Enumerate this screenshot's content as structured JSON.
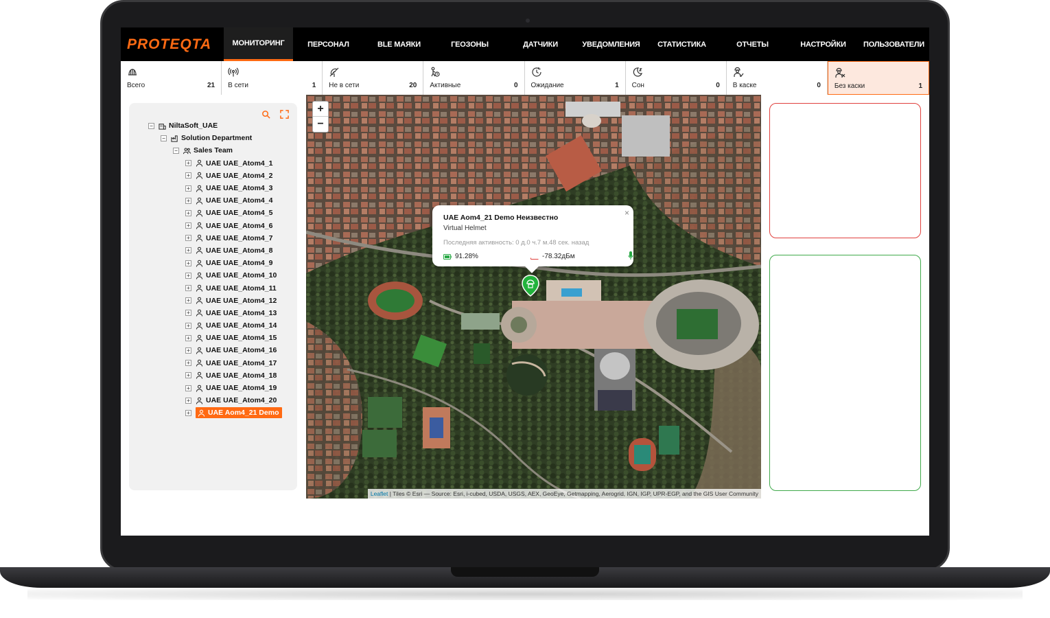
{
  "brand": {
    "logo": "PROTEQTA",
    "accent": "#ff6a13"
  },
  "nav": {
    "items": [
      {
        "label": "МОНИТОРИНГ",
        "active": true
      },
      {
        "label": "ПЕРСОНАЛ"
      },
      {
        "label": "BLE МАЯКИ"
      },
      {
        "label": "ГЕОЗОНЫ"
      },
      {
        "label": "ДАТЧИКИ"
      },
      {
        "label": "УВЕДОМЛЕНИЯ"
      },
      {
        "label": "СТАТИСТИКА"
      },
      {
        "label": "ОТЧЕТЫ"
      },
      {
        "label": "НАСТРОЙКИ"
      },
      {
        "label": "ПОЛЬЗОВАТЕЛИ"
      }
    ]
  },
  "stats": [
    {
      "label": "Всего",
      "value": "21",
      "icon": "helmet-icon"
    },
    {
      "label": "В сети",
      "value": "1",
      "icon": "signal-icon"
    },
    {
      "label": "Не в сети",
      "value": "20",
      "icon": "no-signal-icon"
    },
    {
      "label": "Активные",
      "value": "0",
      "icon": "walking-icon"
    },
    {
      "label": "Ожидание",
      "value": "1",
      "icon": "waiting-icon"
    },
    {
      "label": "Сон",
      "value": "0",
      "icon": "sleep-icon"
    },
    {
      "label": "В каске",
      "value": "0",
      "icon": "worker-helmet-icon"
    },
    {
      "label": "Без каски",
      "value": "1",
      "icon": "worker-no-helmet-icon",
      "highlight": true
    }
  ],
  "tree": {
    "org": "NiltaSoft_UAE",
    "department": "Solution Department",
    "team": "Sales Team",
    "members": [
      "UAE UAE_Atom4_1",
      "UAE UAE_Atom4_2",
      "UAE UAE_Atom4_3",
      "UAE UAE_Atom4_4",
      "UAE UAE_Atom4_5",
      "UAE UAE_Atom4_6",
      "UAE UAE_Atom4_7",
      "UAE UAE_Atom4_8",
      "UAE UAE_Atom4_9",
      "UAE UAE_Atom4_10",
      "UAE UAE_Atom4_11",
      "UAE UAE_Atom4_12",
      "UAE UAE_Atom4_13",
      "UAE UAE_Atom4_14",
      "UAE UAE_Atom4_15",
      "UAE UAE_Atom4_16",
      "UAE UAE_Atom4_17",
      "UAE UAE_Atom4_18",
      "UAE UAE_Atom4_19",
      "UAE UAE_Atom4_20"
    ],
    "selected": "UAE Aom4_21 Demo"
  },
  "map": {
    "zoom_in": "+",
    "zoom_out": "−",
    "attribution_link": "Leaflet",
    "attribution_text": "| Tiles © Esri — Source: Esri, i-cubed, USDA, USGS, AEX, GeoEye, Getmapping, Aerogrid, IGN, IGP, UPR-EGP, and the GIS User Community",
    "popup": {
      "title": "UAE Aom4_21 Demo Неизвестно",
      "subtitle": "Virtual Helmet",
      "activity": "Последняя активность: 0 д.0 ч.7 м.48 сек. назад",
      "battery": "91.28%",
      "signal": "-78.32дБм",
      "close": "×"
    }
  }
}
